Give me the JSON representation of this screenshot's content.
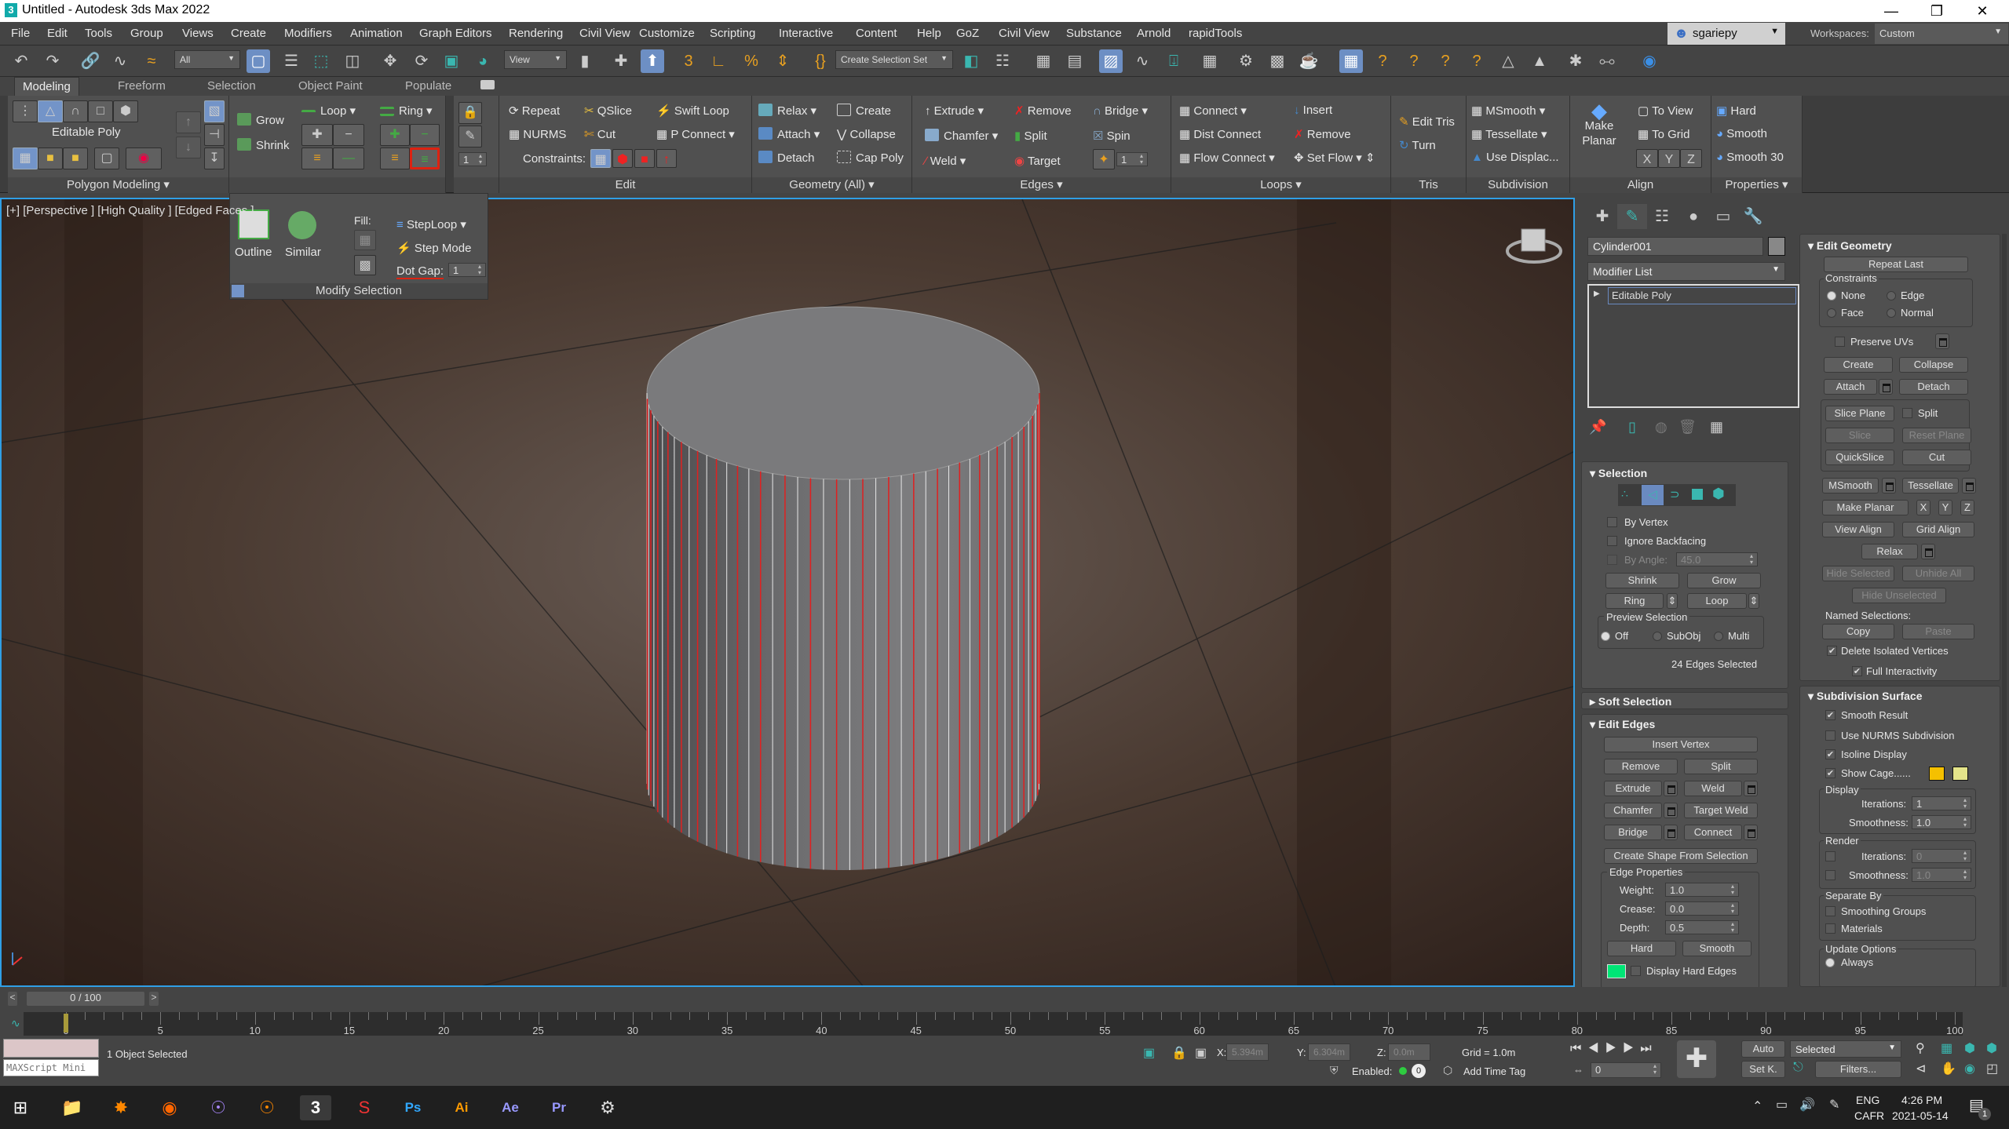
{
  "window": {
    "title": "Untitled - Autodesk 3ds Max 2022",
    "app_icon": "3",
    "controls": [
      "minimize",
      "restore",
      "close"
    ]
  },
  "menu": [
    "File",
    "Edit",
    "Tools",
    "Group",
    "Views",
    "Create",
    "Modifiers",
    "Animation",
    "Graph Editors",
    "Rendering",
    "Civil View",
    "Customize",
    "Scripting",
    "Interactive",
    "Content",
    "Help",
    "GoZ",
    "Civil View",
    "Substance",
    "Arnold",
    "rapidTools"
  ],
  "user": {
    "name": "sgariepy"
  },
  "workspaces": {
    "label": "Workspaces:",
    "value": "Custom"
  },
  "main_toolbar": {
    "selection_filter": "All",
    "ref_coord": "View",
    "selection_set": "Create Selection Set"
  },
  "ribbon": {
    "tabs": [
      "Modeling",
      "Freeform",
      "Selection",
      "Object Paint",
      "Populate"
    ],
    "active_tab": "Modeling",
    "polygon_modeling": {
      "title": "Editable Poly",
      "footer": "Polygon Modeling"
    },
    "modify_selection": {
      "grow": "Grow",
      "shrink": "Shrink",
      "loop": "Loop",
      "ring": "Ring",
      "spinner": "1"
    },
    "edit": {
      "items": [
        "Repeat",
        "QSlice",
        "Swift Loop",
        "NURMS",
        "Cut",
        "P Connect"
      ],
      "constraints_label": "Constraints:",
      "footer": "Edit"
    },
    "geometry": {
      "items": [
        "Relax",
        "Create",
        "Attach",
        "Collapse",
        "Detach",
        "Cap Poly"
      ],
      "footer": "Geometry (All)"
    },
    "edges": {
      "items": [
        "Extrude",
        "Remove",
        "Bridge",
        "Chamfer",
        "Split",
        "Spin",
        "Weld",
        "Target"
      ],
      "spinner": "1",
      "footer": "Edges"
    },
    "loops": {
      "items": [
        "Connect",
        "Insert",
        "Dist Connect",
        "Remove",
        "Flow Connect",
        "Set  Flow"
      ],
      "footer": "Loops"
    },
    "tris": {
      "items": [
        "Edit Tris",
        "Turn"
      ],
      "footer": "Tris"
    },
    "subdivision": {
      "items": [
        "MSmooth",
        "Tessellate",
        "Use Displac..."
      ],
      "footer": "Subdivision"
    },
    "align": {
      "make_planar": "Make Planar",
      "items": [
        "To View",
        "To Grid"
      ],
      "axes": [
        "X",
        "Y",
        "Z"
      ],
      "footer": "Align"
    },
    "properties": {
      "items": [
        "Hard",
        "Smooth",
        "Smooth 30"
      ],
      "footer": "Properties"
    }
  },
  "modify_selection_popup": {
    "outline": "Outline",
    "similar": "Similar",
    "fill_label": "Fill:",
    "steploop": "StepLoop",
    "step_mode": "Step Mode",
    "dot_gap_label": "Dot Gap:",
    "dot_gap_value": "1",
    "footer": "Modify Selection"
  },
  "viewport": {
    "label": "[+] [Perspective ] [High Quality ] [Edged Faces ]",
    "accent": "#2f9fe6",
    "selected_edge_color": "#e02020"
  },
  "command_panel": {
    "object_name": "Cylinder001",
    "modifier_list": "Modifier List",
    "stack": [
      "Editable Poly"
    ],
    "selection": {
      "title": "Selection",
      "by_vertex": "By Vertex",
      "ignore_backfacing": "Ignore Backfacing",
      "by_angle": "By Angle:",
      "by_angle_value": "45.0",
      "shrink": "Shrink",
      "grow": "Grow",
      "ring": "Ring",
      "loop": "Loop",
      "preview_selection": "Preview Selection",
      "preview_options": [
        "Off",
        "SubObj",
        "Multi"
      ],
      "preview_selected": "Off",
      "status": "24 Edges Selected"
    },
    "soft_selection": {
      "title": "Soft Selection"
    },
    "edit_edges": {
      "title": "Edit Edges",
      "insert_vertex": "Insert Vertex",
      "remove": "Remove",
      "split": "Split",
      "extrude": "Extrude",
      "weld": "Weld",
      "chamfer": "Chamfer",
      "target_weld": "Target Weld",
      "bridge": "Bridge",
      "connect": "Connect",
      "create_shape": "Create Shape From Selection",
      "edge_properties": "Edge Properties",
      "weight_label": "Weight:",
      "weight": "1.0",
      "crease_label": "Crease:",
      "crease": "0.0",
      "depth_label": "Depth:",
      "depth": "0.5",
      "hard": "Hard",
      "smooth": "Smooth",
      "display_hard_edges": "Display Hard Edges",
      "hard_edge_color": "#00e676"
    },
    "edit_geometry": {
      "title": "Edit Geometry",
      "repeat_last": "Repeat Last",
      "constraints": "Constraints",
      "constraint_options": [
        "None",
        "Edge",
        "Face",
        "Normal"
      ],
      "constraint_selected": "None",
      "preserve_uvs": "Preserve UVs",
      "create": "Create",
      "collapse": "Collapse",
      "attach": "Attach",
      "detach": "Detach",
      "slice_plane": "Slice Plane",
      "split": "Split",
      "slice": "Slice",
      "reset_plane": "Reset Plane",
      "quickslice": "QuickSlice",
      "cut": "Cut",
      "msmooth": "MSmooth",
      "tessellate": "Tessellate",
      "make_planar": "Make Planar",
      "axes": [
        "X",
        "Y",
        "Z"
      ],
      "view_align": "View Align",
      "grid_align": "Grid Align",
      "relax": "Relax",
      "hide_selected": "Hide Selected",
      "unhide_all": "Unhide All",
      "hide_unselected": "Hide Unselected",
      "named_selections": "Named Selections:",
      "copy": "Copy",
      "paste": "Paste",
      "delete_isolated": "Delete Isolated Vertices",
      "full_interactivity": "Full Interactivity"
    },
    "subdivision_surface": {
      "title": "Subdivision Surface",
      "smooth_result": "Smooth Result",
      "use_nurms": "Use NURMS Subdivision",
      "isoline_display": "Isoline Display",
      "show_cage": "Show Cage......",
      "cage_colors": [
        "#f5c000",
        "#e4e48a"
      ],
      "display": "Display",
      "iterations_label": "Iterations:",
      "display_iterations": "1",
      "smoothness_label": "Smoothness:",
      "display_smoothness": "1.0",
      "render": "Render",
      "render_iterations": "0",
      "render_smoothness": "1.0",
      "separate_by": "Separate By",
      "smoothing_groups": "Smoothing Groups",
      "materials": "Materials",
      "update_options": "Update Options",
      "always": "Always"
    }
  },
  "timeline": {
    "frame": "0 / 100",
    "current": 0,
    "max": 100,
    "labels": [
      0,
      5,
      10,
      15,
      20,
      25,
      30,
      35,
      40,
      45,
      50,
      55,
      60,
      65,
      70,
      75,
      80,
      85,
      90,
      95,
      100
    ]
  },
  "status": {
    "maxscript": "MAXScript Mini",
    "selected": "1 Object Selected",
    "x_label": "X:",
    "x": "5.394m",
    "y_label": "Y:",
    "y": "6.304m",
    "z_label": "Z:",
    "z": "0.0m",
    "grid": "Grid = 1.0m",
    "enabled": "Enabled:",
    "enabled_count": "0",
    "add_time_tag": "Add Time Tag",
    "auto": "Auto",
    "set_key": "Set K.",
    "key_filter": "Selected",
    "filters": "Filters...",
    "frame_field": "0"
  },
  "taskbar": {
    "lang1": "ENG",
    "lang2": "CAFR",
    "time": "4:26 PM",
    "date": "2021-05-14",
    "notifications": "1"
  }
}
